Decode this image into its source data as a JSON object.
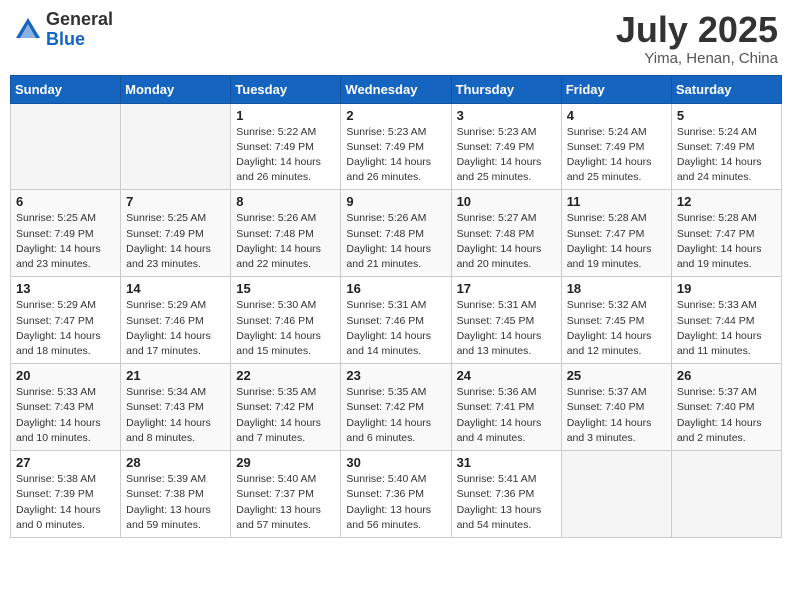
{
  "header": {
    "logo_general": "General",
    "logo_blue": "Blue",
    "month_title": "July 2025",
    "location": "Yima, Henan, China"
  },
  "weekdays": [
    "Sunday",
    "Monday",
    "Tuesday",
    "Wednesday",
    "Thursday",
    "Friday",
    "Saturday"
  ],
  "weeks": [
    [
      {
        "day": "",
        "sunrise": "",
        "sunset": "",
        "daylight": ""
      },
      {
        "day": "",
        "sunrise": "",
        "sunset": "",
        "daylight": ""
      },
      {
        "day": "1",
        "sunrise": "Sunrise: 5:22 AM",
        "sunset": "Sunset: 7:49 PM",
        "daylight": "Daylight: 14 hours and 26 minutes."
      },
      {
        "day": "2",
        "sunrise": "Sunrise: 5:23 AM",
        "sunset": "Sunset: 7:49 PM",
        "daylight": "Daylight: 14 hours and 26 minutes."
      },
      {
        "day": "3",
        "sunrise": "Sunrise: 5:23 AM",
        "sunset": "Sunset: 7:49 PM",
        "daylight": "Daylight: 14 hours and 25 minutes."
      },
      {
        "day": "4",
        "sunrise": "Sunrise: 5:24 AM",
        "sunset": "Sunset: 7:49 PM",
        "daylight": "Daylight: 14 hours and 25 minutes."
      },
      {
        "day": "5",
        "sunrise": "Sunrise: 5:24 AM",
        "sunset": "Sunset: 7:49 PM",
        "daylight": "Daylight: 14 hours and 24 minutes."
      }
    ],
    [
      {
        "day": "6",
        "sunrise": "Sunrise: 5:25 AM",
        "sunset": "Sunset: 7:49 PM",
        "daylight": "Daylight: 14 hours and 23 minutes."
      },
      {
        "day": "7",
        "sunrise": "Sunrise: 5:25 AM",
        "sunset": "Sunset: 7:49 PM",
        "daylight": "Daylight: 14 hours and 23 minutes."
      },
      {
        "day": "8",
        "sunrise": "Sunrise: 5:26 AM",
        "sunset": "Sunset: 7:48 PM",
        "daylight": "Daylight: 14 hours and 22 minutes."
      },
      {
        "day": "9",
        "sunrise": "Sunrise: 5:26 AM",
        "sunset": "Sunset: 7:48 PM",
        "daylight": "Daylight: 14 hours and 21 minutes."
      },
      {
        "day": "10",
        "sunrise": "Sunrise: 5:27 AM",
        "sunset": "Sunset: 7:48 PM",
        "daylight": "Daylight: 14 hours and 20 minutes."
      },
      {
        "day": "11",
        "sunrise": "Sunrise: 5:28 AM",
        "sunset": "Sunset: 7:47 PM",
        "daylight": "Daylight: 14 hours and 19 minutes."
      },
      {
        "day": "12",
        "sunrise": "Sunrise: 5:28 AM",
        "sunset": "Sunset: 7:47 PM",
        "daylight": "Daylight: 14 hours and 19 minutes."
      }
    ],
    [
      {
        "day": "13",
        "sunrise": "Sunrise: 5:29 AM",
        "sunset": "Sunset: 7:47 PM",
        "daylight": "Daylight: 14 hours and 18 minutes."
      },
      {
        "day": "14",
        "sunrise": "Sunrise: 5:29 AM",
        "sunset": "Sunset: 7:46 PM",
        "daylight": "Daylight: 14 hours and 17 minutes."
      },
      {
        "day": "15",
        "sunrise": "Sunrise: 5:30 AM",
        "sunset": "Sunset: 7:46 PM",
        "daylight": "Daylight: 14 hours and 15 minutes."
      },
      {
        "day": "16",
        "sunrise": "Sunrise: 5:31 AM",
        "sunset": "Sunset: 7:46 PM",
        "daylight": "Daylight: 14 hours and 14 minutes."
      },
      {
        "day": "17",
        "sunrise": "Sunrise: 5:31 AM",
        "sunset": "Sunset: 7:45 PM",
        "daylight": "Daylight: 14 hours and 13 minutes."
      },
      {
        "day": "18",
        "sunrise": "Sunrise: 5:32 AM",
        "sunset": "Sunset: 7:45 PM",
        "daylight": "Daylight: 14 hours and 12 minutes."
      },
      {
        "day": "19",
        "sunrise": "Sunrise: 5:33 AM",
        "sunset": "Sunset: 7:44 PM",
        "daylight": "Daylight: 14 hours and 11 minutes."
      }
    ],
    [
      {
        "day": "20",
        "sunrise": "Sunrise: 5:33 AM",
        "sunset": "Sunset: 7:43 PM",
        "daylight": "Daylight: 14 hours and 10 minutes."
      },
      {
        "day": "21",
        "sunrise": "Sunrise: 5:34 AM",
        "sunset": "Sunset: 7:43 PM",
        "daylight": "Daylight: 14 hours and 8 minutes."
      },
      {
        "day": "22",
        "sunrise": "Sunrise: 5:35 AM",
        "sunset": "Sunset: 7:42 PM",
        "daylight": "Daylight: 14 hours and 7 minutes."
      },
      {
        "day": "23",
        "sunrise": "Sunrise: 5:35 AM",
        "sunset": "Sunset: 7:42 PM",
        "daylight": "Daylight: 14 hours and 6 minutes."
      },
      {
        "day": "24",
        "sunrise": "Sunrise: 5:36 AM",
        "sunset": "Sunset: 7:41 PM",
        "daylight": "Daylight: 14 hours and 4 minutes."
      },
      {
        "day": "25",
        "sunrise": "Sunrise: 5:37 AM",
        "sunset": "Sunset: 7:40 PM",
        "daylight": "Daylight: 14 hours and 3 minutes."
      },
      {
        "day": "26",
        "sunrise": "Sunrise: 5:37 AM",
        "sunset": "Sunset: 7:40 PM",
        "daylight": "Daylight: 14 hours and 2 minutes."
      }
    ],
    [
      {
        "day": "27",
        "sunrise": "Sunrise: 5:38 AM",
        "sunset": "Sunset: 7:39 PM",
        "daylight": "Daylight: 14 hours and 0 minutes."
      },
      {
        "day": "28",
        "sunrise": "Sunrise: 5:39 AM",
        "sunset": "Sunset: 7:38 PM",
        "daylight": "Daylight: 13 hours and 59 minutes."
      },
      {
        "day": "29",
        "sunrise": "Sunrise: 5:40 AM",
        "sunset": "Sunset: 7:37 PM",
        "daylight": "Daylight: 13 hours and 57 minutes."
      },
      {
        "day": "30",
        "sunrise": "Sunrise: 5:40 AM",
        "sunset": "Sunset: 7:36 PM",
        "daylight": "Daylight: 13 hours and 56 minutes."
      },
      {
        "day": "31",
        "sunrise": "Sunrise: 5:41 AM",
        "sunset": "Sunset: 7:36 PM",
        "daylight": "Daylight: 13 hours and 54 minutes."
      },
      {
        "day": "",
        "sunrise": "",
        "sunset": "",
        "daylight": ""
      },
      {
        "day": "",
        "sunrise": "",
        "sunset": "",
        "daylight": ""
      }
    ]
  ]
}
